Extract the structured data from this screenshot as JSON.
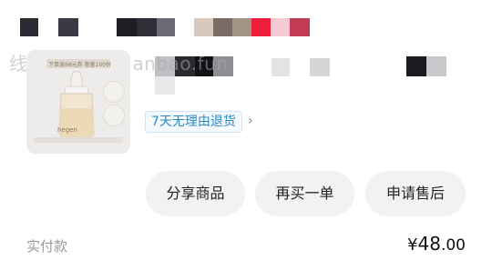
{
  "watermark": "线报酷-new.xianbao.fun",
  "thumbnail": {
    "banner_text": "下单返68元券 限量100份",
    "brand_text": "hegen"
  },
  "return_tag": "7天无理由退货",
  "buttons": {
    "share": "分享商品",
    "rebuy": "再买一单",
    "after_sale": "申请售后"
  },
  "payment": {
    "label": "实付款",
    "currency": "¥",
    "amount_integer": "48",
    "amount_decimal": ".00"
  },
  "colors": {
    "tag_text": "#2a8cc7",
    "button_bg": "#f2f2f2"
  }
}
